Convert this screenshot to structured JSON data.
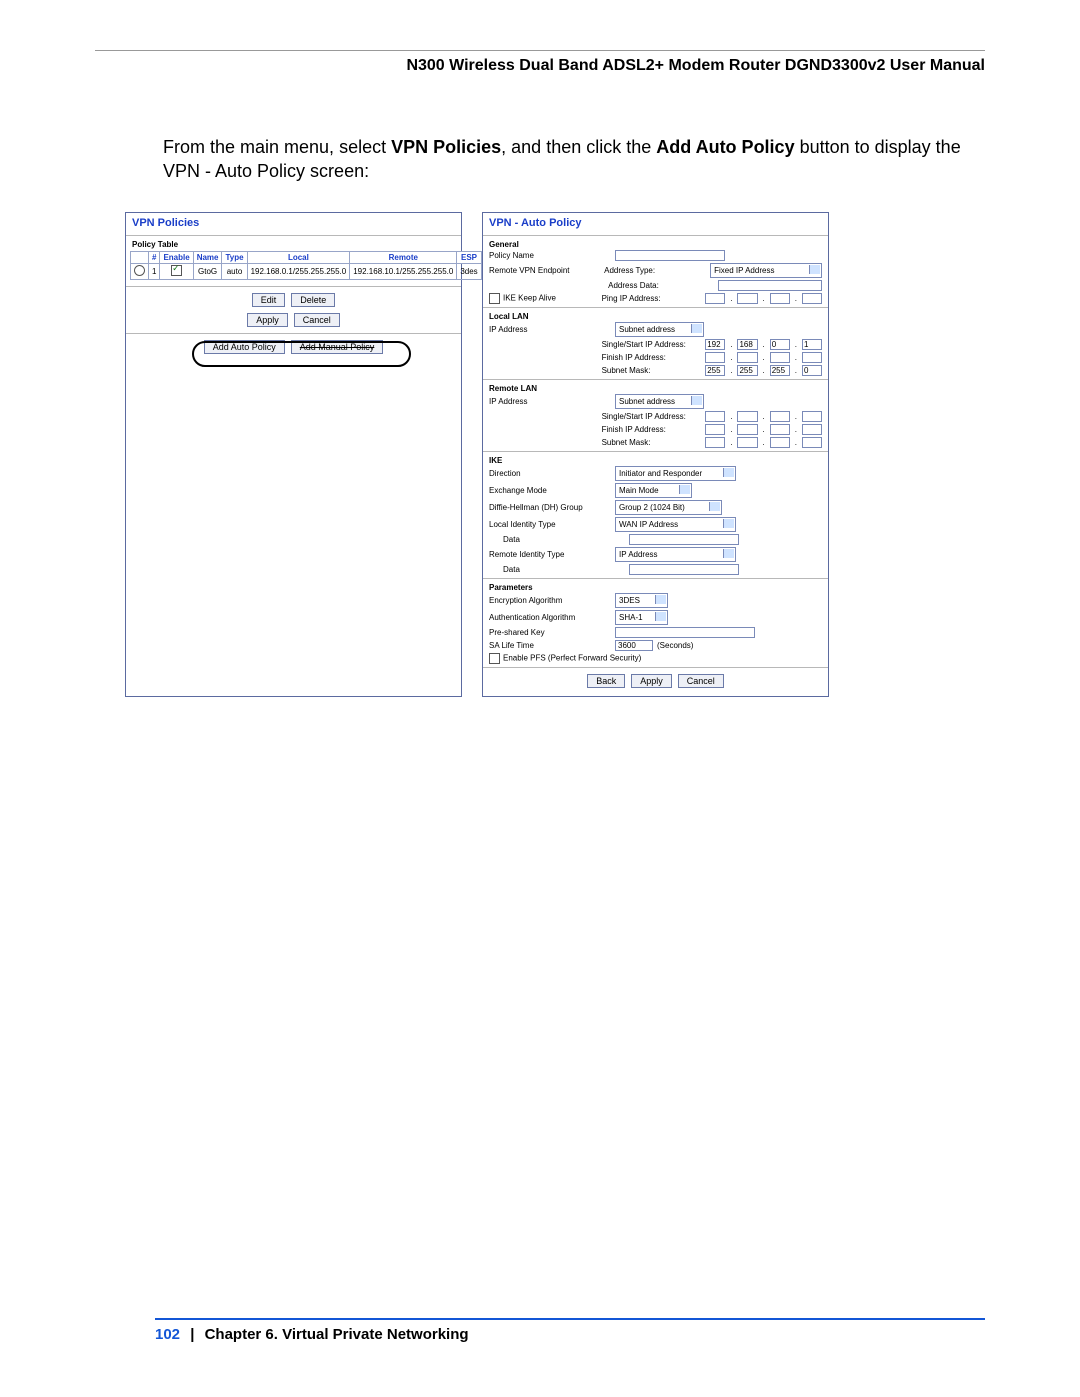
{
  "header_title": "N300 Wireless Dual Band ADSL2+ Modem Router DGND3300v2 User Manual",
  "body": {
    "pre": "From the main menu, select ",
    "b1": "VPN Policies",
    "mid": ", and then click the ",
    "b2": "Add Auto Policy",
    "post": " button to display the VPN - Auto Policy screen:"
  },
  "left": {
    "title": "VPN Policies",
    "table_caption": "Policy Table",
    "headers": [
      "#",
      "Enable",
      "Name",
      "Type",
      "Local",
      "Remote",
      "ESP"
    ],
    "row": {
      "num": "1",
      "name": "GtoG",
      "type": "auto",
      "local": "192.168.0.1/255.255.255.0",
      "remote": "192.168.10.1/255.255.255.0",
      "esp": "3des"
    },
    "buttons": {
      "edit": "Edit",
      "delete": "Delete",
      "apply": "Apply",
      "cancel": "Cancel",
      "add_auto": "Add Auto Policy",
      "add_manual": "Add Manual Policy"
    }
  },
  "right": {
    "title": "VPN - Auto Policy",
    "general": {
      "h": "General",
      "policy_name": "Policy Name",
      "remote_endpoint": "Remote VPN Endpoint",
      "address_type": "Address Type:",
      "address_type_val": "Fixed IP Address",
      "address_data": "Address Data:",
      "ike_keepalive": "IKE Keep Alive",
      "ping_ip": "Ping IP Address:"
    },
    "local_lan": {
      "h": "Local LAN",
      "ip_addr": "IP Address",
      "ip_addr_val": "Subnet address",
      "single_start": "Single/Start IP Address:",
      "finish": "Finish IP Address:",
      "subnet": "Subnet Mask:",
      "start_oct": [
        "192",
        "168",
        "0",
        "1"
      ],
      "mask_oct": [
        "255",
        "255",
        "255",
        "0"
      ]
    },
    "remote_lan": {
      "h": "Remote LAN",
      "ip_addr": "IP Address",
      "ip_addr_val": "Subnet address",
      "single_start": "Single/Start IP Address:",
      "finish": "Finish IP Address:",
      "subnet": "Subnet Mask:"
    },
    "ike": {
      "h": "IKE",
      "direction": "Direction",
      "direction_val": "Initiator and Responder",
      "exchange": "Exchange Mode",
      "exchange_val": "Main Mode",
      "dh": "Diffie-Hellman (DH) Group",
      "dh_val": "Group 2 (1024 Bit)",
      "local_id": "Local Identity Type",
      "local_id_val": "WAN IP Address",
      "data": "Data",
      "remote_id": "Remote Identity Type",
      "remote_id_val": "IP Address"
    },
    "params": {
      "h": "Parameters",
      "enc": "Encryption Algorithm",
      "enc_val": "3DES",
      "auth": "Authentication Algorithm",
      "auth_val": "SHA-1",
      "psk": "Pre-shared Key",
      "life": "SA Life Time",
      "life_val": "3600",
      "seconds": "(Seconds)",
      "pfs": "Enable PFS (Perfect Forward Security)"
    },
    "buttons": {
      "back": "Back",
      "apply": "Apply",
      "cancel": "Cancel"
    }
  },
  "footer": {
    "page": "102",
    "sep": "|",
    "chapter": "Chapter 6.  Virtual Private Networking"
  }
}
